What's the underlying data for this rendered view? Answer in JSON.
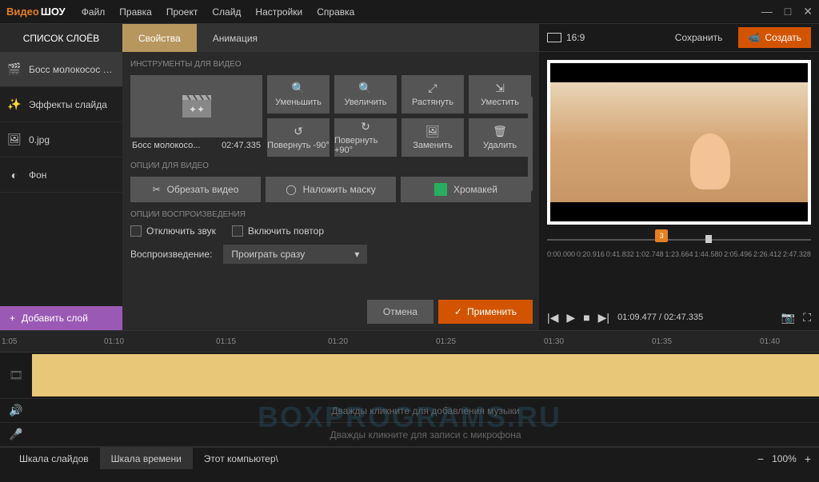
{
  "app": {
    "logo_video": "Видео",
    "logo_show": "ШОУ"
  },
  "menu": [
    "Файл",
    "Правка",
    "Проект",
    "Слайд",
    "Настройки",
    "Справка"
  ],
  "left": {
    "header": "СПИСОК СЛОЁВ",
    "layers": [
      {
        "icon": "film",
        "label": "Босс молокосос — ..."
      },
      {
        "icon": "wand",
        "label": "Эффекты слайда"
      },
      {
        "icon": "image",
        "label": "0.jpg"
      },
      {
        "icon": "bg",
        "label": "Фон"
      }
    ],
    "add_layer": "Добавить слой"
  },
  "center": {
    "tabs": {
      "properties": "Свойства",
      "animation": "Анимация"
    },
    "section_video_tools": "ИНСТРУМЕНТЫ ДЛЯ ВИДЕО",
    "thumb_name": "Босс молокосо...",
    "thumb_duration": "02:47.335",
    "tools": [
      "Уменьшить",
      "Увеличить",
      "Растянуть",
      "Уместить",
      "Повернуть -90°",
      "Повернуть +90°",
      "Заменить",
      "Удалить"
    ],
    "section_video_opts": "ОПЦИИ ДЛЯ ВИДЕО",
    "video_opts": {
      "trim": "Обрезать видео",
      "mask": "Наложить маску",
      "chroma": "Хромакей"
    },
    "section_play": "ОПЦИИ ВОСПРОИЗВЕДЕНИЯ",
    "mute": "Отключить звук",
    "loop": "Включить повтор",
    "playback_label": "Воспроизведение:",
    "playback_value": "Проиграть сразу",
    "cancel": "Отмена",
    "apply": "Применить"
  },
  "right": {
    "aspect": "16:9",
    "save": "Сохранить",
    "create": "Создать",
    "slider_value": "3",
    "time_marks": [
      "0:00.000",
      "0:20.916",
      "0:41.832",
      "1:02.748",
      "1:23.664",
      "1:44.580",
      "2:05.496",
      "2:26.412",
      "2:47.328"
    ],
    "current_time": "01:09.477",
    "total_time": "02:47.335"
  },
  "timeline": {
    "ruler": [
      "1:05",
      "01:10",
      "01:15",
      "01:20",
      "01:25",
      "01:30",
      "01:35",
      "01:40"
    ],
    "music_hint": "Дважды кликните для добавления музыки",
    "mic_hint": "Дважды кликните для записи с микрофона"
  },
  "bottom": {
    "tabs": [
      "Шкала слайдов",
      "Шкала времени",
      "Этот компьютер\\"
    ],
    "zoom": "100%"
  },
  "watermark": "BOXPROGRAMS.RU"
}
